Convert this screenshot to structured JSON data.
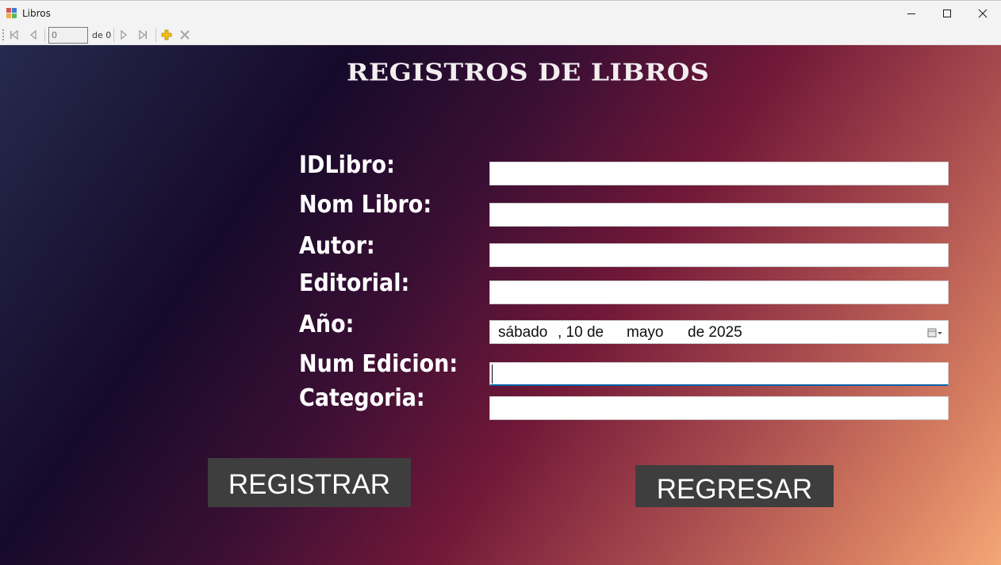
{
  "window": {
    "title": "Libros",
    "icon": "window-forms-app-icon",
    "controls": [
      "minimize-icon",
      "maximize-icon",
      "close-icon"
    ]
  },
  "navigator": {
    "position_value": "0",
    "count_label": "de 0",
    "buttons": [
      "move-first-icon",
      "move-previous-icon",
      "move-next-icon",
      "move-last-icon",
      "add-new-icon",
      "delete-icon"
    ],
    "add_icon_color": "#e8a800"
  },
  "form": {
    "heading": "REGISTROS DE LIBROS",
    "labels": {
      "id": "IDLibro:",
      "name": "Nom Libro:",
      "author": "Autor:",
      "publisher": "Editorial:",
      "year": "Año:",
      "edition": "Num Edicion:",
      "category": "Categoria:"
    },
    "values": {
      "id": "",
      "name": "",
      "author": "",
      "publisher": "",
      "edition": "",
      "category": ""
    },
    "year_picker": {
      "weekday": "sábado",
      "day_part": ", 10 de",
      "month": "mayo",
      "year_part": "de 2025",
      "button_icon": "calendar-dropdown-icon"
    },
    "focused_field": "edition"
  },
  "buttons": {
    "register": "REGISTRAR",
    "back": "REGRESAR"
  },
  "colors": {
    "button_bg": "#3e3e3e",
    "gradient": [
      "#252a4e",
      "#160a2a",
      "#721838",
      "#f4a777"
    ],
    "focus_accent": "#0a5fa8"
  }
}
